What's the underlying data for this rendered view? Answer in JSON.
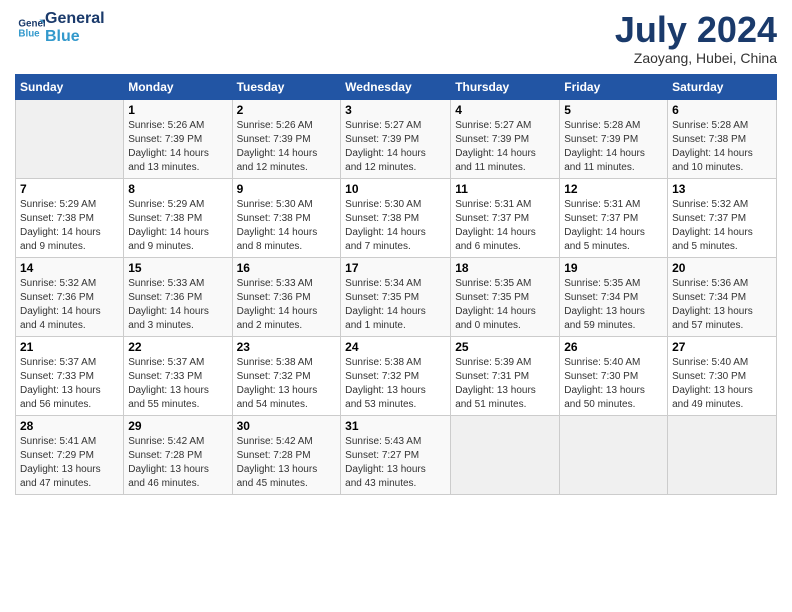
{
  "header": {
    "logo_line1": "General",
    "logo_line2": "Blue",
    "month_title": "July 2024",
    "subtitle": "Zaoyang, Hubei, China"
  },
  "columns": [
    "Sunday",
    "Monday",
    "Tuesday",
    "Wednesday",
    "Thursday",
    "Friday",
    "Saturday"
  ],
  "weeks": [
    [
      {
        "day": "",
        "info": ""
      },
      {
        "day": "1",
        "info": "Sunrise: 5:26 AM\nSunset: 7:39 PM\nDaylight: 14 hours\nand 13 minutes."
      },
      {
        "day": "2",
        "info": "Sunrise: 5:26 AM\nSunset: 7:39 PM\nDaylight: 14 hours\nand 12 minutes."
      },
      {
        "day": "3",
        "info": "Sunrise: 5:27 AM\nSunset: 7:39 PM\nDaylight: 14 hours\nand 12 minutes."
      },
      {
        "day": "4",
        "info": "Sunrise: 5:27 AM\nSunset: 7:39 PM\nDaylight: 14 hours\nand 11 minutes."
      },
      {
        "day": "5",
        "info": "Sunrise: 5:28 AM\nSunset: 7:39 PM\nDaylight: 14 hours\nand 11 minutes."
      },
      {
        "day": "6",
        "info": "Sunrise: 5:28 AM\nSunset: 7:38 PM\nDaylight: 14 hours\nand 10 minutes."
      }
    ],
    [
      {
        "day": "7",
        "info": "Sunrise: 5:29 AM\nSunset: 7:38 PM\nDaylight: 14 hours\nand 9 minutes."
      },
      {
        "day": "8",
        "info": "Sunrise: 5:29 AM\nSunset: 7:38 PM\nDaylight: 14 hours\nand 9 minutes."
      },
      {
        "day": "9",
        "info": "Sunrise: 5:30 AM\nSunset: 7:38 PM\nDaylight: 14 hours\nand 8 minutes."
      },
      {
        "day": "10",
        "info": "Sunrise: 5:30 AM\nSunset: 7:38 PM\nDaylight: 14 hours\nand 7 minutes."
      },
      {
        "day": "11",
        "info": "Sunrise: 5:31 AM\nSunset: 7:37 PM\nDaylight: 14 hours\nand 6 minutes."
      },
      {
        "day": "12",
        "info": "Sunrise: 5:31 AM\nSunset: 7:37 PM\nDaylight: 14 hours\nand 5 minutes."
      },
      {
        "day": "13",
        "info": "Sunrise: 5:32 AM\nSunset: 7:37 PM\nDaylight: 14 hours\nand 5 minutes."
      }
    ],
    [
      {
        "day": "14",
        "info": "Sunrise: 5:32 AM\nSunset: 7:36 PM\nDaylight: 14 hours\nand 4 minutes."
      },
      {
        "day": "15",
        "info": "Sunrise: 5:33 AM\nSunset: 7:36 PM\nDaylight: 14 hours\nand 3 minutes."
      },
      {
        "day": "16",
        "info": "Sunrise: 5:33 AM\nSunset: 7:36 PM\nDaylight: 14 hours\nand 2 minutes."
      },
      {
        "day": "17",
        "info": "Sunrise: 5:34 AM\nSunset: 7:35 PM\nDaylight: 14 hours\nand 1 minute."
      },
      {
        "day": "18",
        "info": "Sunrise: 5:35 AM\nSunset: 7:35 PM\nDaylight: 14 hours\nand 0 minutes."
      },
      {
        "day": "19",
        "info": "Sunrise: 5:35 AM\nSunset: 7:34 PM\nDaylight: 13 hours\nand 59 minutes."
      },
      {
        "day": "20",
        "info": "Sunrise: 5:36 AM\nSunset: 7:34 PM\nDaylight: 13 hours\nand 57 minutes."
      }
    ],
    [
      {
        "day": "21",
        "info": "Sunrise: 5:37 AM\nSunset: 7:33 PM\nDaylight: 13 hours\nand 56 minutes."
      },
      {
        "day": "22",
        "info": "Sunrise: 5:37 AM\nSunset: 7:33 PM\nDaylight: 13 hours\nand 55 minutes."
      },
      {
        "day": "23",
        "info": "Sunrise: 5:38 AM\nSunset: 7:32 PM\nDaylight: 13 hours\nand 54 minutes."
      },
      {
        "day": "24",
        "info": "Sunrise: 5:38 AM\nSunset: 7:32 PM\nDaylight: 13 hours\nand 53 minutes."
      },
      {
        "day": "25",
        "info": "Sunrise: 5:39 AM\nSunset: 7:31 PM\nDaylight: 13 hours\nand 51 minutes."
      },
      {
        "day": "26",
        "info": "Sunrise: 5:40 AM\nSunset: 7:30 PM\nDaylight: 13 hours\nand 50 minutes."
      },
      {
        "day": "27",
        "info": "Sunrise: 5:40 AM\nSunset: 7:30 PM\nDaylight: 13 hours\nand 49 minutes."
      }
    ],
    [
      {
        "day": "28",
        "info": "Sunrise: 5:41 AM\nSunset: 7:29 PM\nDaylight: 13 hours\nand 47 minutes."
      },
      {
        "day": "29",
        "info": "Sunrise: 5:42 AM\nSunset: 7:28 PM\nDaylight: 13 hours\nand 46 minutes."
      },
      {
        "day": "30",
        "info": "Sunrise: 5:42 AM\nSunset: 7:28 PM\nDaylight: 13 hours\nand 45 minutes."
      },
      {
        "day": "31",
        "info": "Sunrise: 5:43 AM\nSunset: 7:27 PM\nDaylight: 13 hours\nand 43 minutes."
      },
      {
        "day": "",
        "info": ""
      },
      {
        "day": "",
        "info": ""
      },
      {
        "day": "",
        "info": ""
      }
    ]
  ]
}
